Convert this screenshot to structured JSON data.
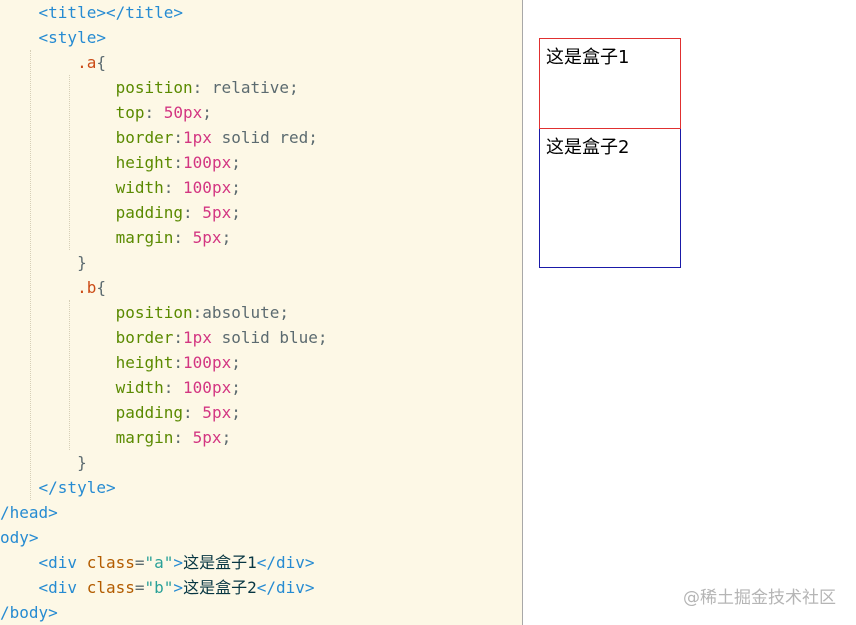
{
  "code": {
    "title_tag": [
      "<title>",
      "</title>"
    ],
    "style_open": "<style>",
    "rule_a": {
      "selector": ".a",
      "open": "{",
      "decls": [
        {
          "prop": "position",
          "sep": ": ",
          "plain": "relative;"
        },
        {
          "prop": "top",
          "sep": ": ",
          "num": "50",
          "unit": "px",
          "end": ";"
        },
        {
          "prop": "border",
          "sep": ":",
          "num": "1",
          "unit": "px",
          "plain": " solid red;"
        },
        {
          "prop": "height",
          "sep": ":",
          "num": "100",
          "unit": "px",
          "end": ";"
        },
        {
          "prop": "width",
          "sep": ": ",
          "num": "100",
          "unit": "px",
          "end": ";"
        },
        {
          "prop": "padding",
          "sep": ": ",
          "num": "5",
          "unit": "px",
          "end": ";"
        },
        {
          "prop": "margin",
          "sep": ": ",
          "num": "5",
          "unit": "px",
          "end": ";"
        }
      ],
      "close": "}"
    },
    "rule_b": {
      "selector": ".b",
      "open": "{",
      "decls": [
        {
          "prop": "position",
          "sep": ":",
          "plain": "absolute;"
        },
        {
          "prop": "border",
          "sep": ":",
          "num": "1",
          "unit": "px",
          "plain": " solid blue;"
        },
        {
          "prop": "height",
          "sep": ":",
          "num": "100",
          "unit": "px",
          "end": ";"
        },
        {
          "prop": "width",
          "sep": ": ",
          "num": "100",
          "unit": "px",
          "end": ";"
        },
        {
          "prop": "padding",
          "sep": ": ",
          "num": "5",
          "unit": "px",
          "end": ";"
        },
        {
          "prop": "margin",
          "sep": ": ",
          "num": "5",
          "unit": "px",
          "end": ";"
        }
      ],
      "close": "}"
    },
    "style_close": "</style>",
    "head_close": "/head>",
    "body_open": "ody>",
    "div_a": {
      "open": "<div ",
      "attr": "class",
      "eq": "=",
      "val": "\"a\"",
      "gt": ">",
      "text": "这是盒子1",
      "close": "</div>"
    },
    "div_b": {
      "open": "<div ",
      "attr": "class",
      "eq": "=",
      "val": "\"b\"",
      "gt": ">",
      "text": "这是盒子2",
      "close": "</div>"
    },
    "body_close": "/body>"
  },
  "preview": {
    "box_a_text": "这是盒子1",
    "box_b_text": "这是盒子2"
  },
  "watermark": "@稀土掘金技术社区",
  "colors": {
    "editor_bg": "#fdf8e6",
    "box_a_border": "#e03030",
    "box_b_border": "#1a1aa8"
  }
}
